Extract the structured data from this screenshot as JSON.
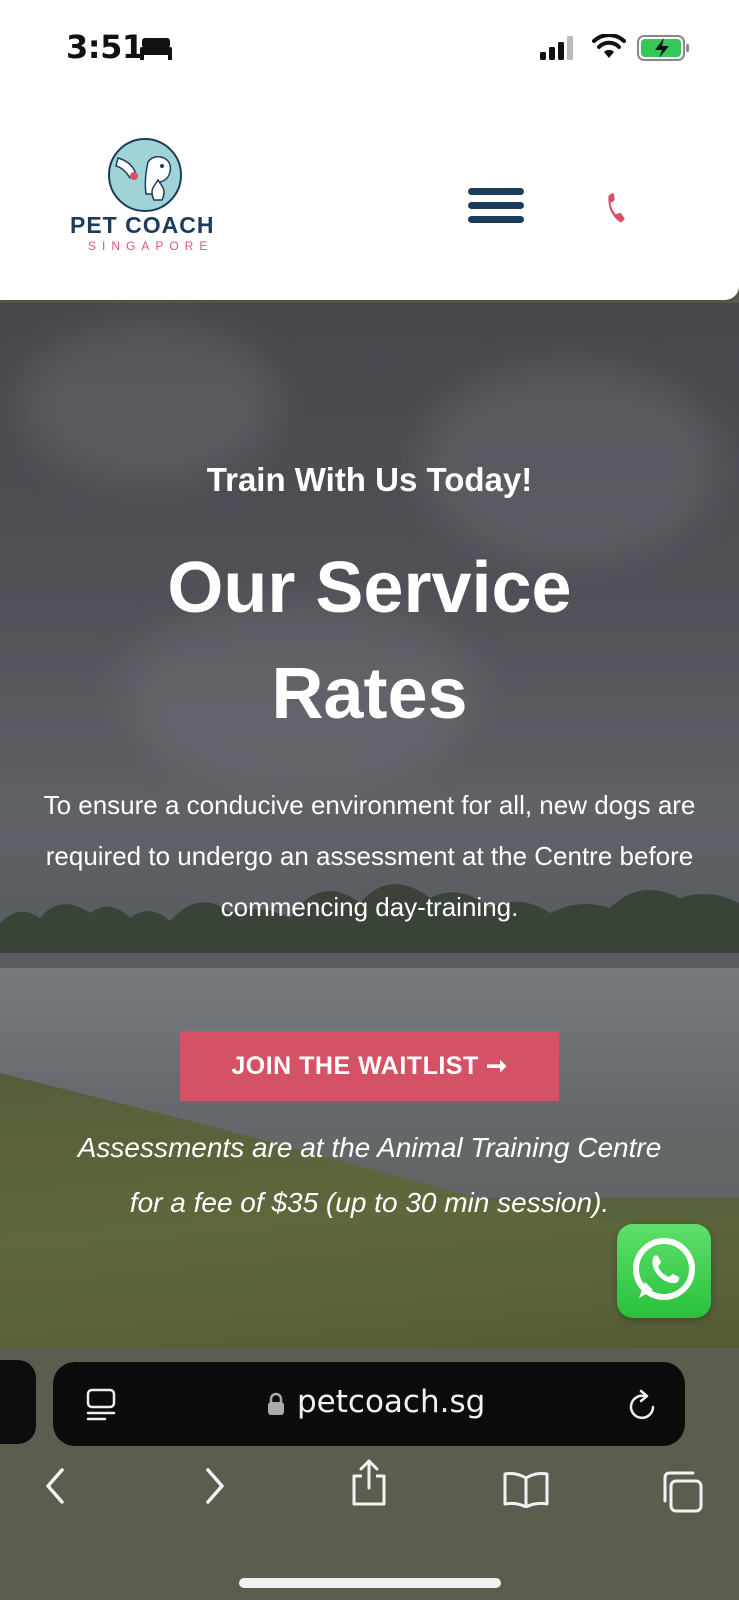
{
  "status_bar": {
    "time": "3:51",
    "icons": [
      "bed-icon",
      "signal-icon",
      "wifi-icon",
      "battery-charging-icon"
    ]
  },
  "header": {
    "logo_title": "PET COACH",
    "logo_subtitle": "SINGAPORE",
    "menu_icon": "hamburger-menu-icon",
    "phone_icon": "phone-icon"
  },
  "hero": {
    "tagline": "Train With Us Today!",
    "title": "Our Service Rates",
    "description": "To ensure a conducive environment for all, new dogs are required to undergo an assessment at the Centre before commencing day-training.",
    "cta_label": "JOIN THE WAITLIST ➞",
    "note": "Assessments are at the Animal Training Centre for a fee of $35 (up to 30 min session)."
  },
  "floating": {
    "whatsapp_icon": "whatsapp-icon"
  },
  "browser": {
    "url": "petcoach.sg",
    "nav_icons": [
      "back-icon",
      "forward-icon",
      "share-icon",
      "bookmarks-icon",
      "tabs-icon"
    ]
  },
  "colors": {
    "brand_navy": "#1d3c5c",
    "brand_pink": "#d55166",
    "whatsapp_green": "#27c13d"
  }
}
